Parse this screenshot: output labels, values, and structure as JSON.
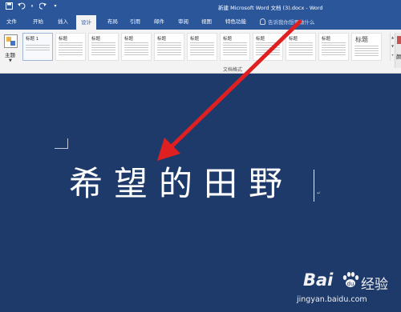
{
  "window": {
    "title": "新建 Microsoft Word 文档 (3).docx - Word"
  },
  "qat": {
    "save_icon": "save-icon",
    "undo_icon": "undo-icon",
    "redo_icon": "redo-icon",
    "customize_icon": "customize-icon"
  },
  "tabs": [
    {
      "label": "文件"
    },
    {
      "label": "开始"
    },
    {
      "label": "插入"
    },
    {
      "label": "设计"
    },
    {
      "label": "布局"
    },
    {
      "label": "引用"
    },
    {
      "label": "邮件"
    },
    {
      "label": "审阅"
    },
    {
      "label": "视图"
    },
    {
      "label": "特色功能"
    }
  ],
  "active_tab": "设计",
  "tell_me": "告诉我你想要做什么",
  "ribbon": {
    "theme_label": "主题",
    "group_label": "文档格式",
    "right_label": "颜",
    "styles": [
      {
        "title": "标题 1"
      },
      {
        "title": "标题"
      },
      {
        "title": "标题"
      },
      {
        "title": "标题"
      },
      {
        "title": "标题"
      },
      {
        "title": "标题"
      },
      {
        "title": "标题"
      },
      {
        "title": "标题"
      },
      {
        "title": "标题"
      },
      {
        "title": "标题"
      },
      {
        "title": "标题"
      }
    ]
  },
  "document": {
    "heading": "希望的田野"
  },
  "watermark": {
    "logo": "Bai",
    "product": "经验",
    "url": "jingyan.baidu.com"
  },
  "colors": {
    "ribbon_blue": "#2b579a",
    "doc_background": "#1d3a6a",
    "arrow": "#e02020"
  }
}
